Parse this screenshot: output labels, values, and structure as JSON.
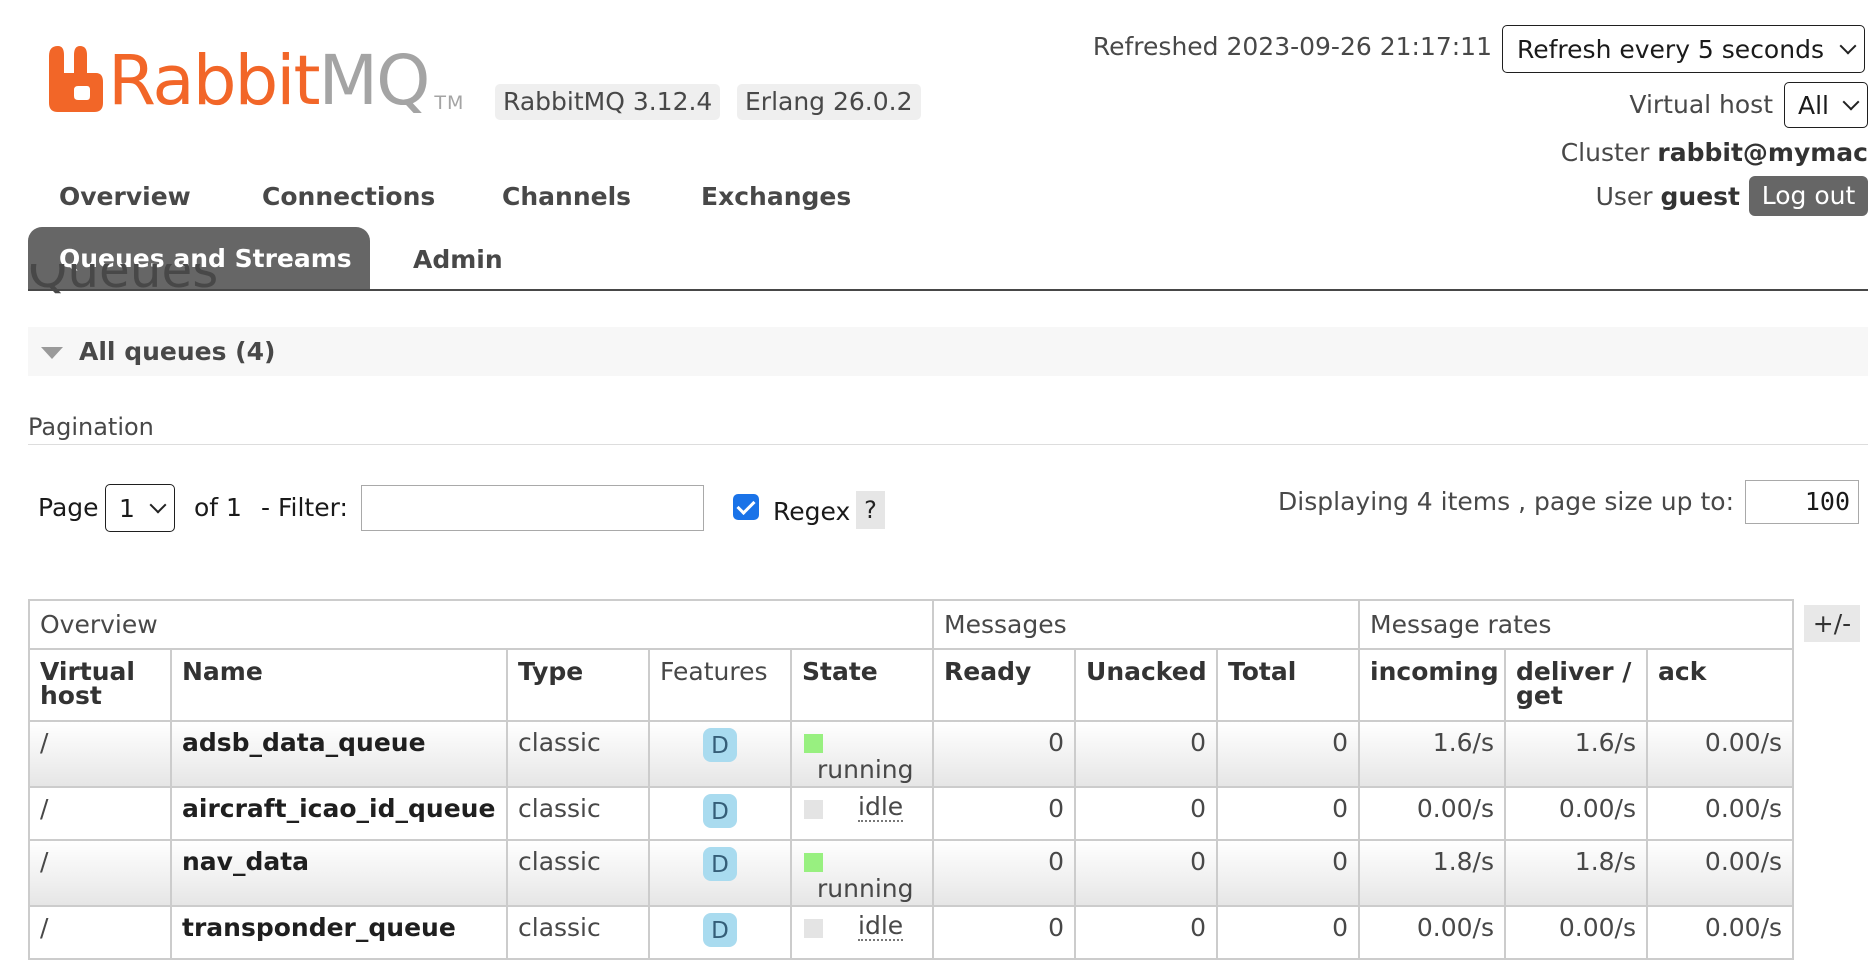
{
  "brand": {
    "logo_rabbit": "Rabbit",
    "logo_mq": "MQ",
    "logo_tm": "TM",
    "brand_color": "#f26628"
  },
  "versions": {
    "rabbitmq": "RabbitMQ 3.12.4",
    "erlang": "Erlang 26.0.2"
  },
  "status": {
    "refreshed": "Refreshed 2023-09-26 21:17:11",
    "refresh_option": "Refresh every 5 seconds",
    "vhost_label": "Virtual host",
    "vhost_value": "All",
    "cluster_label": "Cluster",
    "cluster_value": "rabbit@mymac",
    "user_label": "User",
    "user_value": "guest",
    "logout": "Log out"
  },
  "nav": {
    "overview": "Overview",
    "connections": "Connections",
    "channels": "Channels",
    "exchanges": "Exchanges",
    "queues": "Queues and Streams",
    "admin": "Admin",
    "active_color": "#666666"
  },
  "page": {
    "title": "Queues",
    "section": "All queues (4)",
    "pagination": "Pagination"
  },
  "filters": {
    "page_label": "Page",
    "page_value": "1",
    "of_label": "of 1",
    "filter_label": "- Filter:",
    "filter_value": "",
    "regex_label": "Regex",
    "regex_checked": true,
    "help": "?",
    "display_info": "Displaying 4 items , page size up to:",
    "page_size": "100"
  },
  "table": {
    "groups": {
      "overview": "Overview",
      "messages": "Messages",
      "rates": "Message rates"
    },
    "columns": {
      "vhost": "Virtual host",
      "name": "Name",
      "type": "Type",
      "features": "Features",
      "state": "State",
      "ready": "Ready",
      "unacked": "Unacked",
      "total": "Total",
      "incoming": "incoming",
      "deliver_get": "deliver / get",
      "ack": "ack"
    },
    "toggle_columns": "+/-",
    "rows": [
      {
        "vhost": "/",
        "name": "adsb_data_queue",
        "type": "classic",
        "features": "D",
        "state": "running",
        "ready": "0",
        "unacked": "0",
        "total": "0",
        "incoming": "1.6/s",
        "deliver_get": "1.6/s",
        "ack": "0.00/s"
      },
      {
        "vhost": "/",
        "name": "aircraft_icao_id_queue",
        "type": "classic",
        "features": "D",
        "state": "idle",
        "ready": "0",
        "unacked": "0",
        "total": "0",
        "incoming": "0.00/s",
        "deliver_get": "0.00/s",
        "ack": "0.00/s"
      },
      {
        "vhost": "/",
        "name": "nav_data",
        "type": "classic",
        "features": "D",
        "state": "running",
        "ready": "0",
        "unacked": "0",
        "total": "0",
        "incoming": "1.8/s",
        "deliver_get": "1.8/s",
        "ack": "0.00/s"
      },
      {
        "vhost": "/",
        "name": "transponder_queue",
        "type": "classic",
        "features": "D",
        "state": "idle",
        "ready": "0",
        "unacked": "0",
        "total": "0",
        "incoming": "0.00/s",
        "deliver_get": "0.00/s",
        "ack": "0.00/s"
      }
    ],
    "state_colors": {
      "running": "#98f080",
      "idle": "#e4e4e4"
    }
  }
}
